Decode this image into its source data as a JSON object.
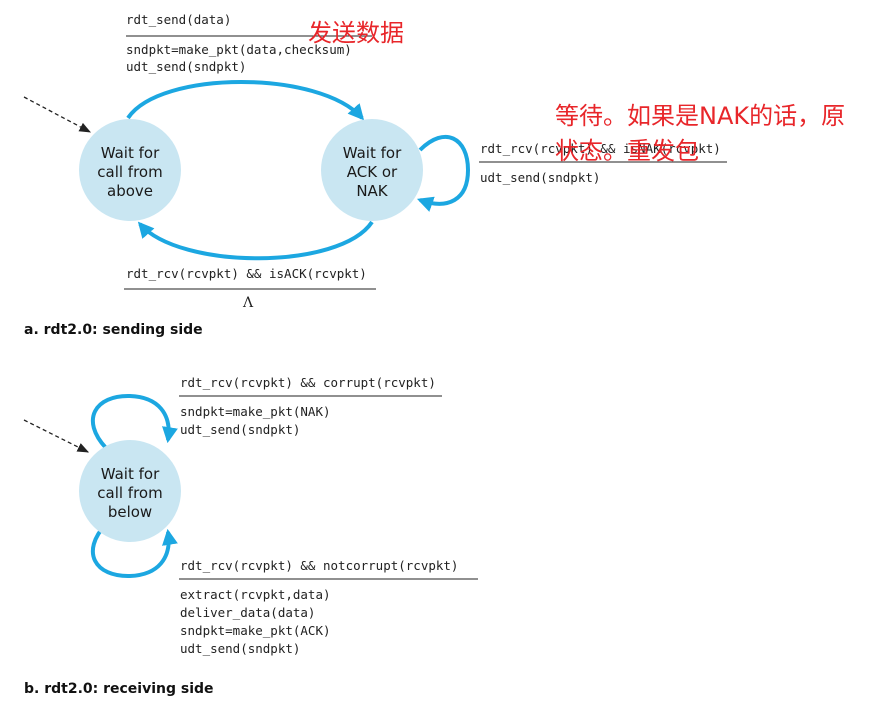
{
  "sending_side": {
    "caption": "a. rdt2.0: sending side",
    "state_wait_call_above": [
      "Wait for",
      "call from",
      "above"
    ],
    "state_wait_ack_nak": [
      "Wait for",
      "ACK or",
      "NAK"
    ],
    "send_event": "rdt_send(data)",
    "send_actions": [
      "sndpkt=make_pkt(data,checksum)",
      "udt_send(sndpkt)"
    ],
    "nak_event": "rdt_rcv(rcvpkt) && isNAK(rcvpkt)",
    "nak_action": "udt_send(sndpkt)",
    "ack_event": "rdt_rcv(rcvpkt) && isACK(rcvpkt)",
    "ack_action": "Λ"
  },
  "receiving_side": {
    "caption": "b. rdt2.0: receiving side",
    "state_wait_call_below": [
      "Wait for",
      "call from",
      "below"
    ],
    "corrupt_event": "rdt_rcv(rcvpkt) && corrupt(rcvpkt)",
    "corrupt_actions": [
      "sndpkt=make_pkt(NAK)",
      "udt_send(sndpkt)"
    ],
    "notcorrupt_event": "rdt_rcv(rcvpkt) && notcorrupt(rcvpkt)",
    "notcorrupt_actions": [
      "extract(rcvpkt,data)",
      "deliver_data(data)",
      "sndpkt=make_pkt(ACK)",
      "udt_send(sndpkt)"
    ]
  },
  "annotations": {
    "send_data_note": "发送数据",
    "wait_note_line1": "等待。如果是NAK的话，原",
    "wait_note_line2": "状态。重发包"
  },
  "colors": {
    "state_fill": "#c9e6f2",
    "arrow": "#1ca7e1",
    "annotation": "#e8262a"
  }
}
